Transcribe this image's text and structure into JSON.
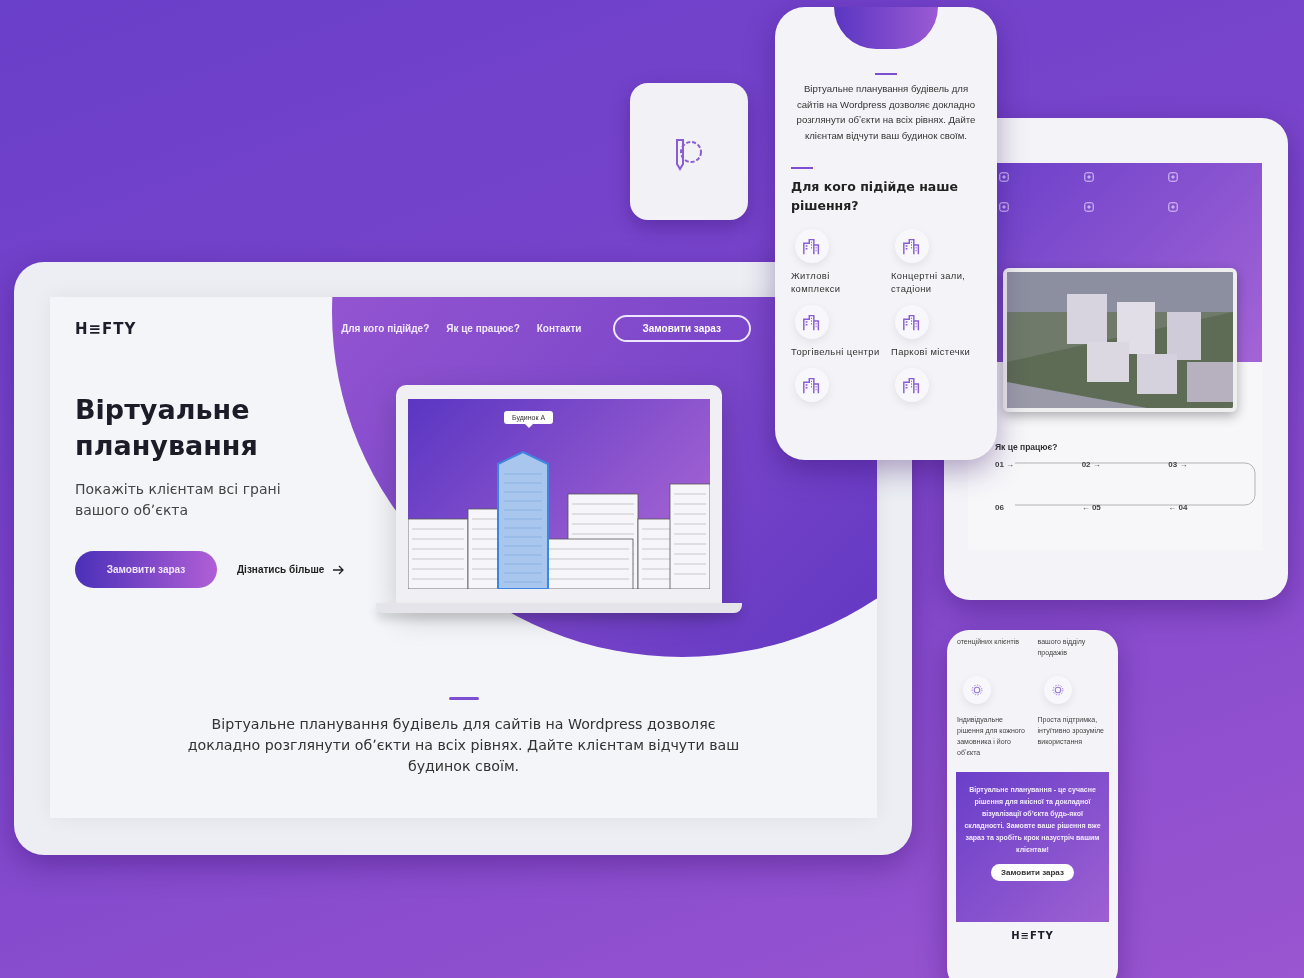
{
  "desktop": {
    "logo": "H≡FTY",
    "nav": [
      "Для кого підійде?",
      "Як це працює?",
      "Контакти"
    ],
    "nav_button": "Замовити зараз",
    "title": "Віртуальне планування",
    "subtitle": "Покажіть клієнтам всі грані вашого обʼєкта",
    "primary_button": "Замовити зараз",
    "secondary_link": "Дізнатись більше",
    "building_tooltip": "Будинок А",
    "description": "Віртуальне планування будівель для сайтів на Wordpress дозволяє докладно розглянути обʼєкти на всіх рівнях. Дайте клієнтам відчути ваш будинок своїм."
  },
  "phone_top": {
    "description": "Віртуальне планування будівель для сайтів на Wordpress дозволяє докладно розглянути обʼєкти на всіх рівнях. Дайте клієнтам відчути ваш будинок своїм.",
    "heading": "Для кого підійде наше рішення?",
    "categories": [
      {
        "label": "Житлові комплекси"
      },
      {
        "label": "Концертні зали, стадіони"
      },
      {
        "label": "Торгівельні центри"
      },
      {
        "label": "Паркові містечки"
      }
    ]
  },
  "tablet": {
    "heading": "Як це працює?",
    "steps": [
      "01 →",
      "02 →",
      "03 →",
      "06",
      "← 05",
      "← 04"
    ]
  },
  "phone_bottom": {
    "top_texts": [
      "отенційних клієнтів",
      "вашого відділу продажів"
    ],
    "features": [
      "Індивідуальне рішення для кожного замовника і його обʼєкта",
      "Проста підтримка, інтуїтивно зрозуміле використання"
    ],
    "cta_text": "Віртуальне планування - це сучасне рішення для якісної та докладної візуалізації обʼєкта будь-якої складності. Замовте ваше рішення вже зараз та зробіть крок назустріч вашим клієнтам!",
    "cta_button": "Замовити зараз",
    "logo": "H≡FTY"
  }
}
